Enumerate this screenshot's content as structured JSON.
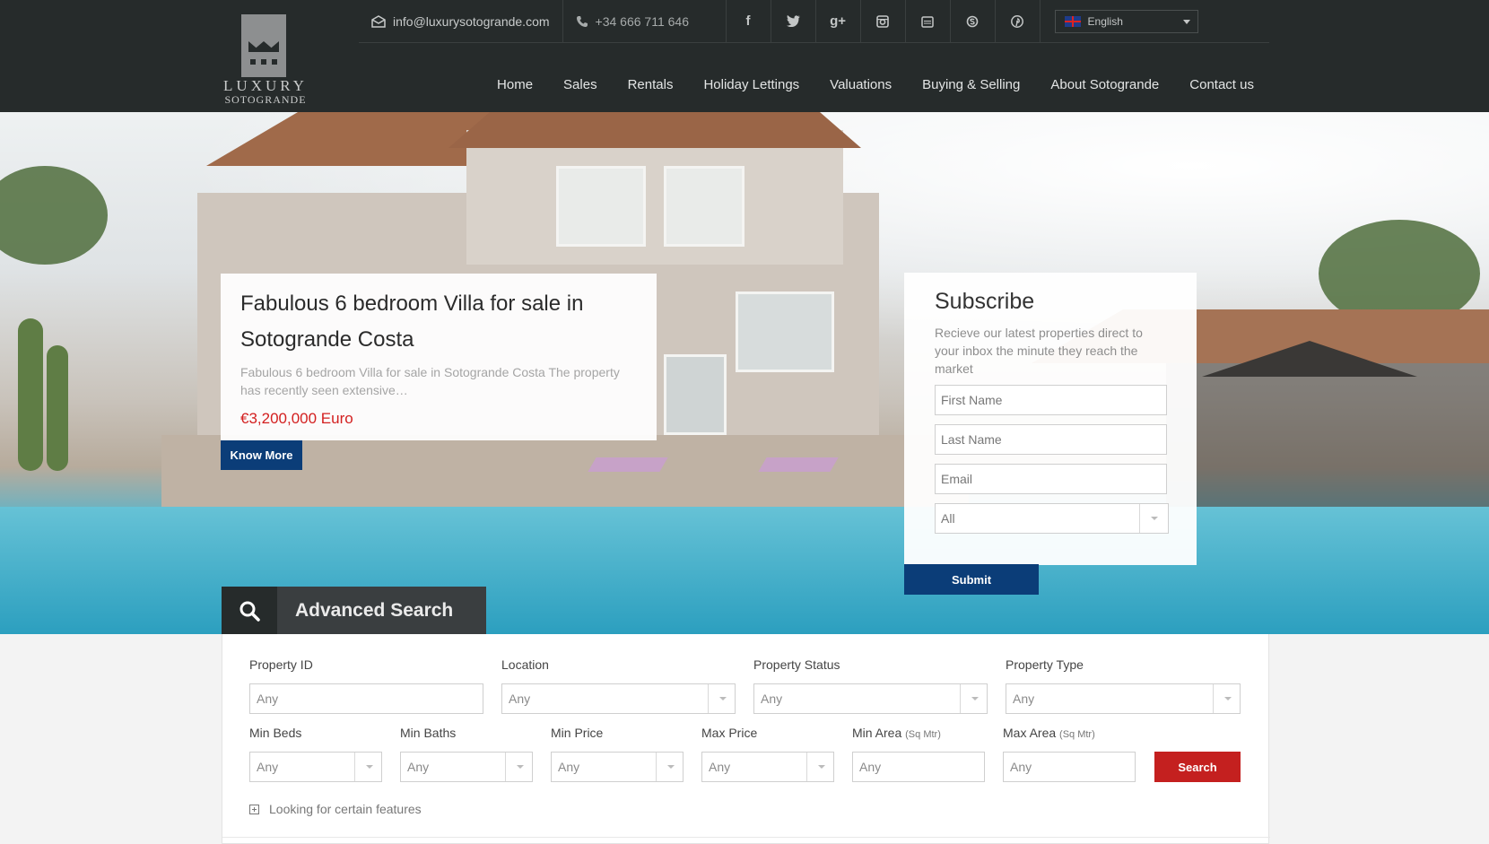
{
  "header": {
    "logo": {
      "name": "LUXURY",
      "sub": "SOTOGRANDE"
    },
    "email": "info@luxurysotogrande.com",
    "phone": "+34 666 711 646",
    "socials": [
      "facebook-icon",
      "twitter-icon",
      "google-plus-icon",
      "instagram-icon",
      "youtube-icon",
      "skype-icon",
      "pinterest-icon"
    ],
    "language": "English",
    "nav": [
      "Home",
      "Sales",
      "Rentals",
      "Holiday Lettings",
      "Valuations",
      "Buying & Selling",
      "About Sotogrande",
      "Contact us"
    ]
  },
  "featured": {
    "title": "Fabulous 6 bedroom Villa for sale in Sotogrande Costa",
    "description": "Fabulous 6 bedroom Villa for sale in Sotogrande Costa The property has recently seen extensive…",
    "price": "€3,200,000 Euro",
    "button": "Know More"
  },
  "subscribe": {
    "title": "Subscribe",
    "text": "Recieve our latest properties direct to your inbox the minute they reach the market",
    "first_name": "First Name",
    "last_name": "Last Name",
    "email": "Email",
    "select_value": "All",
    "submit": "Submit"
  },
  "advanced_search": {
    "title": "Advanced Search",
    "labels": {
      "property_id": "Property ID",
      "location": "Location",
      "property_status": "Property Status",
      "property_type": "Property Type",
      "min_beds": "Min Beds",
      "min_baths": "Min Baths",
      "min_price": "Min Price",
      "max_price": "Max Price",
      "min_area": "Min Area",
      "max_area": "Max Area",
      "area_unit": "(Sq Mtr)"
    },
    "any": "Any",
    "search_button": "Search",
    "features_link": "Looking for certain features"
  },
  "colors": {
    "header_bg": "#262b2b",
    "accent_blue": "#0b3d78",
    "accent_red": "#c4201f",
    "price_red": "#d31f1f"
  }
}
